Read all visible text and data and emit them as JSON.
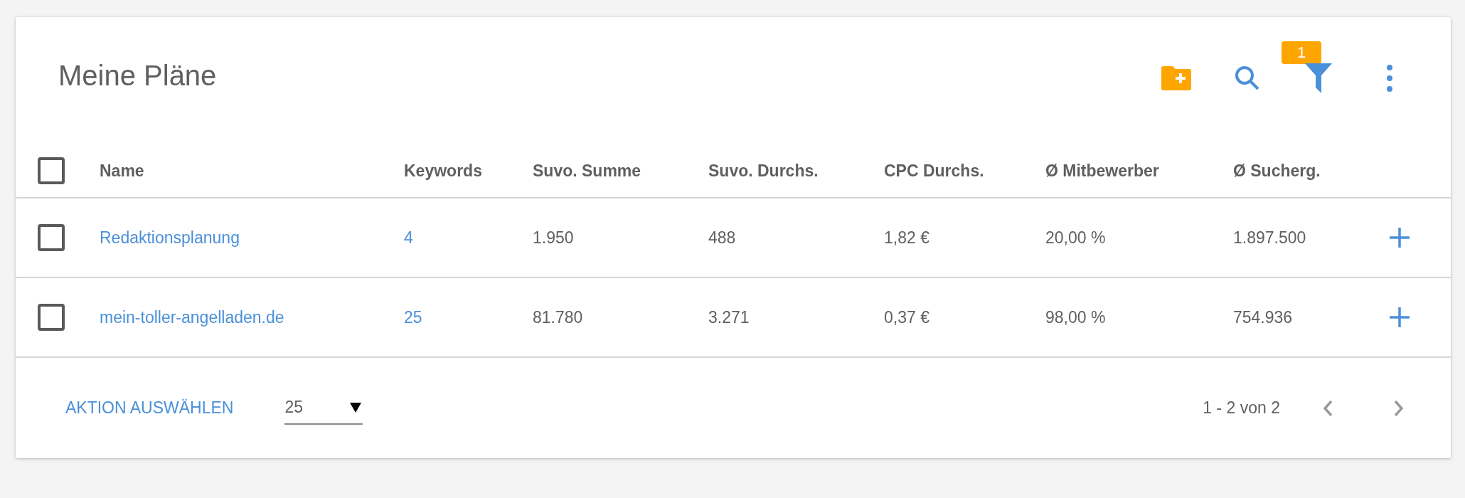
{
  "title": "Meine Pläne",
  "toolbar": {
    "filter_badge": "1"
  },
  "table": {
    "header_checked": false,
    "columns": [
      "Name",
      "Keywords",
      "Suvo. Summe",
      "Suvo. Durchs.",
      "CPC Durchs.",
      "Ø Mitbewerber",
      "Ø Sucherg."
    ],
    "rows": [
      {
        "checked": false,
        "cells": [
          "Redaktionsplanung",
          "4",
          "1.950",
          "488",
          "1,82 €",
          "20,00 %",
          "1.897.500"
        ]
      },
      {
        "checked": false,
        "cells": [
          "mein-toller-angelladen.de",
          "25",
          "81.780",
          "3.271",
          "0,37 €",
          "98,00 %",
          "754.936"
        ]
      }
    ]
  },
  "footer": {
    "action": "AKTION AUSWÄHLEN",
    "page_size": "25",
    "range": "1 - 2 von 2"
  }
}
